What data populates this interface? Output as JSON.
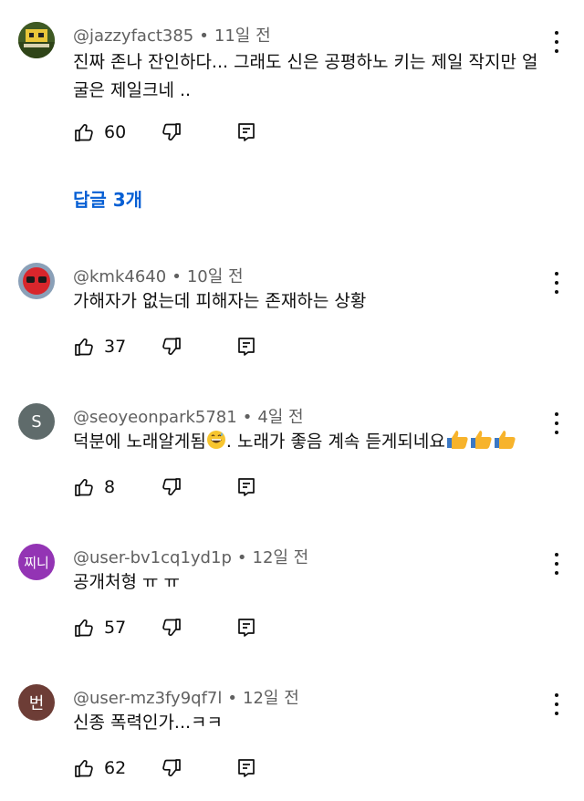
{
  "comments": [
    {
      "handle": "@jazzyfact385",
      "time": "11일 전",
      "text": "진짜 존나 잔인하다... 그래도 신은 공평하노 키는 제일 작지만 얼굴은 제일크네 ..",
      "likes": "60",
      "avatar_icon": "photo-avatar-icon",
      "avatar_letter": ""
    },
    {
      "handle": "@kmk4640",
      "time": "10일 전",
      "text": "가해자가 없는데 피해자는 존재하는 상황",
      "likes": "37",
      "avatar_icon": "red-mask-avatar-icon",
      "avatar_letter": ""
    },
    {
      "handle": "@seoyeonpark5781",
      "time": "4일 전",
      "text": "덕분에 노래알게됨",
      "text2": ". 노래가 좋음 계속 듣게되네요",
      "likes": "8",
      "avatar_letter": "S",
      "avatar_color": "#5f6b6b"
    },
    {
      "handle": "@user-bv1cq1yd1p",
      "time": "12일 전",
      "text": "공개처형 ㅠ ㅠ",
      "likes": "57",
      "avatar_letter": "찌니",
      "avatar_color": "#9334b4"
    },
    {
      "handle": "@user-mz3fy9qf7l",
      "time": "12일 전",
      "text": "신종 폭력인가...ㅋㅋ",
      "likes": "62",
      "avatar_letter": "번",
      "avatar_color": "#6d3d36"
    }
  ],
  "replies_label": "답글 3개",
  "colors": {
    "link_blue": "#065fd4",
    "meta_gray": "#606060"
  },
  "icons": [
    "thumbs-up-icon",
    "thumbs-down-icon",
    "reply-icon",
    "more-vert-icon",
    "grinning-sweat-emoji",
    "thumbs-up-emoji"
  ]
}
